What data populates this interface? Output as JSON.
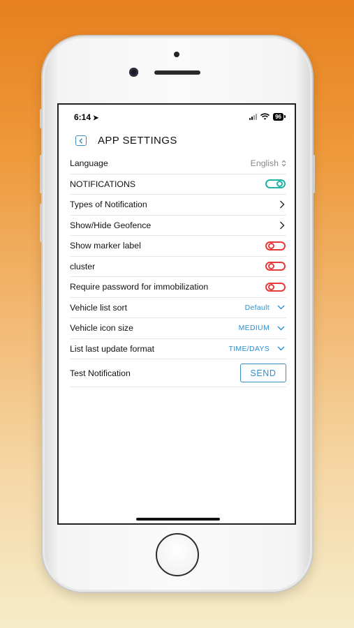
{
  "status_bar": {
    "time": "6:14",
    "battery": "96"
  },
  "header": {
    "title": "APP SETTINGS"
  },
  "settings": [
    {
      "label": "Language",
      "value": "English"
    },
    {
      "label": "NOTIFICATIONS",
      "toggle": "on"
    },
    {
      "label": "Types of Notification"
    },
    {
      "label": "Show/Hide Geofence"
    },
    {
      "label": "Show marker label",
      "toggle": "off"
    },
    {
      "label": "cluster",
      "toggle": "off"
    },
    {
      "label": "Require password for immobilization",
      "toggle": "off"
    },
    {
      "label": "Vehicle list sort",
      "value": "Default"
    },
    {
      "label": "Vehicle icon size",
      "value": "MEDIUM"
    },
    {
      "label": "List last update format",
      "value": "TIME/DAYS"
    },
    {
      "label": "Test Notification",
      "button": "SEND"
    }
  ],
  "colors": {
    "accent_blue": "#2a8fcf",
    "toggle_on": "#20b3a2",
    "toggle_off": "#e63a3a"
  }
}
